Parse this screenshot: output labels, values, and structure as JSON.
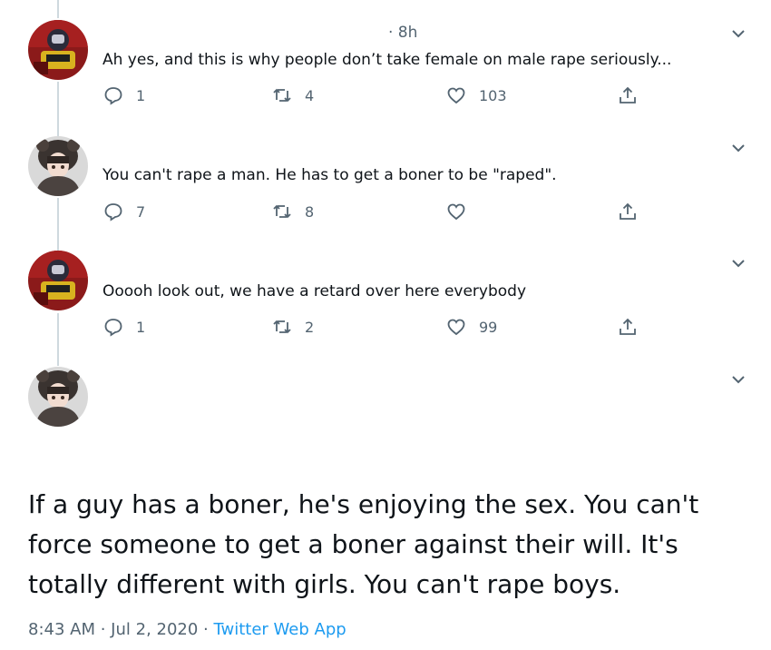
{
  "thread": [
    {
      "time": "· 8h",
      "text": "Ah yes, and this is why people don’t take female on male rape seriously...",
      "reply_count": "1",
      "retweet_count": "4",
      "like_count": "103",
      "avatar_icon": "robot-avatar"
    },
    {
      "time": "",
      "text": "You can't rape a man. He has to get a boner to be \"raped\".",
      "reply_count": "7",
      "retweet_count": "8",
      "like_count": "",
      "avatar_icon": "anime-girl-avatar"
    },
    {
      "time": "",
      "text": "Ooooh look out, we have a retard over here everybody",
      "reply_count": "1",
      "retweet_count": "2",
      "like_count": "99",
      "avatar_icon": "robot-avatar"
    },
    {
      "avatar_icon": "anime-girl-avatar"
    }
  ],
  "main_tweet": {
    "line1": "If a guy has a boner, he's enjoying the sex. You can't",
    "line2": "force someone to get a boner against their will. It's",
    "line3": "totally different with girls. You can't rape boys.",
    "time": "8:43 AM",
    "sep1": " · ",
    "date": "Jul 2, 2020",
    "sep2": " · ",
    "source": "Twitter Web App"
  },
  "colors": {
    "text": "#0f1419",
    "muted": "#536471",
    "link": "#1d9bf0",
    "thread_line": "#cfd9de"
  }
}
